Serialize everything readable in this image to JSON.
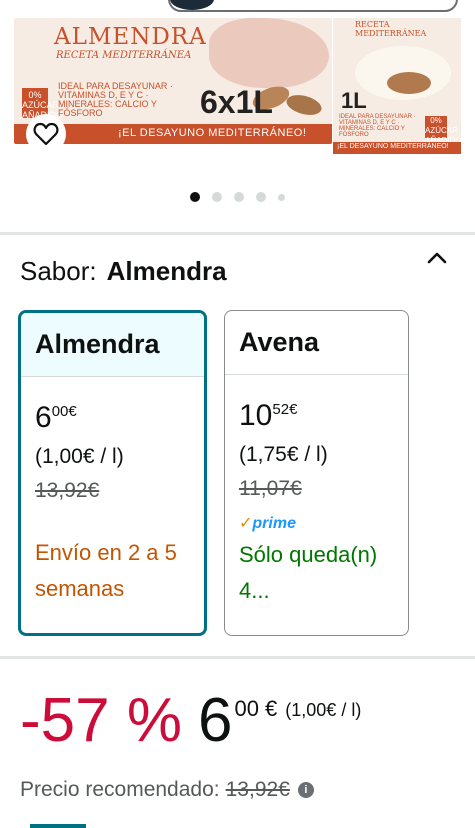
{
  "product_image": {
    "brand": "ALMENDRA",
    "subtitle": "RECETA MEDITERRÁNEA",
    "zero_badge": "0% AZÚCAR AÑADIDO",
    "ideal": "IDEAL PARA DESAYUNAR · VITAMINAS D, E Y C · MINERALES: CALCIO Y FÓSFORO",
    "pack_size": "6x1L",
    "band_text": "¡EL DESAYUNO MEDITERRÁNEO!",
    "small_brand": "RECETA MEDITERRÁNEA",
    "small_liter": "1L",
    "small_band": "¡EL DESAYUNO MEDITERRÁNEO!",
    "favorite_icon": "heart-outline-icon"
  },
  "carousel": {
    "total": 5,
    "active_index": 0
  },
  "variation": {
    "label": "Sabor:",
    "selected": "Almendra",
    "collapse_icon": "chevron-up-icon"
  },
  "options": [
    {
      "name": "Almendra",
      "price_whole": "6",
      "price_fraction": "00",
      "currency": "€",
      "unit_price": "(1,00€ / l)",
      "list_price": "13,92€",
      "prime": false,
      "availability": "Envío en 2 a 5 semanas",
      "availability_color": "#c45500",
      "selected": true
    },
    {
      "name": "Avena",
      "price_whole": "10",
      "price_fraction": "52",
      "currency": "€",
      "unit_price": "(1,75€ / l)",
      "list_price": "11,07€",
      "prime": true,
      "prime_label": "prime",
      "availability": "Sólo queda(n) 4...",
      "availability_color": "#007600",
      "selected": false
    }
  ],
  "deal": {
    "discount": "-57 %",
    "price_whole": "6",
    "price_fraction": "00 €",
    "unit_price": "(1,00€ / l)",
    "discount_color": "#cc0c39"
  },
  "recommended": {
    "label": "Precio recomendado:",
    "price": "13,92€",
    "info_icon": "info-icon"
  },
  "colors": {
    "accent": "#007185",
    "selected_bg": "#edfdff",
    "prime_blue": "#1a98ff"
  }
}
